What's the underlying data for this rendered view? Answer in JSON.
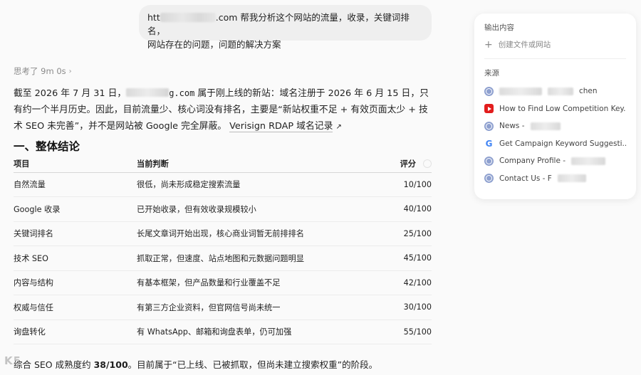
{
  "user_message": {
    "prefix": "htt",
    "suffix": ".com  帮我分析这个网站的流量，收录，关键词排名，",
    "line2": "网站存在的问题，问题的解决方案"
  },
  "thought": {
    "label": "思考了 9m 0s"
  },
  "intro": {
    "p1": "截至 2026 年 7 月 31 日，",
    "domain_tail": "g.com",
    "p2": " 属于刚上线的新站：域名注册于 2026 年 6 月 15 日，只有约一个半月历史。因此，目前流量少、核心词没有排名，主要是“新站权重不足 + 有效页面太少 + 技术 SEO 未完善”，并不是网站被 Google 完全屏蔽。",
    "link": "Verisign RDAP 域名记录",
    "link_arrow": "↗"
  },
  "section_title": "一、整体结论",
  "table": {
    "headers": [
      "项目",
      "当前判断",
      "评分"
    ],
    "rows": [
      [
        "自然流量",
        "很低，尚未形成稳定搜索流量",
        "10/100"
      ],
      [
        "Google 收录",
        "已开始收录，但有效收录规模较小",
        "40/100"
      ],
      [
        "关键词排名",
        "长尾文章词开始出现，核心商业词暂无前排排名",
        "25/100"
      ],
      [
        "技术 SEO",
        "抓取正常，但速度、站点地图和元数据问题明显",
        "45/100"
      ],
      [
        "内容与结构",
        "有基本框架，但产品数量和行业覆盖不足",
        "42/100"
      ],
      [
        "权威与信任",
        "有第三方企业资料，但官网信号尚未统一",
        "30/100"
      ],
      [
        "询盘转化",
        "有 WhatsApp、邮箱和询盘表单，仍可加强",
        "55/100"
      ]
    ]
  },
  "conclusion": {
    "pre": "综合 SEO 成熟度约 ",
    "score": "38/100",
    "post": "。目前属于“已上线、已被抓取，但尚未建立搜索权重”的阶段。"
  },
  "watermark": "K5",
  "panel": {
    "output_title": "输出内容",
    "create_label": "创建文件或网站",
    "sources_title": "来源",
    "sources": [
      {
        "icon": "globe-icon",
        "text": "chen"
      },
      {
        "icon": "youtube-icon",
        "text": "How to Find Low Competition Key..."
      },
      {
        "icon": "globe-icon",
        "text": "News - "
      },
      {
        "icon": "google-icon",
        "text": "Get Campaign Keyword Suggesti..."
      },
      {
        "icon": "globe-icon",
        "text": "Company Profile - "
      },
      {
        "icon": "globe-icon",
        "text": "Contact Us - F"
      }
    ]
  },
  "colors": {
    "bubble": "#efefef",
    "youtube": "#e21d1d",
    "google": "#4285f4",
    "globe": "#8ea0cf"
  }
}
